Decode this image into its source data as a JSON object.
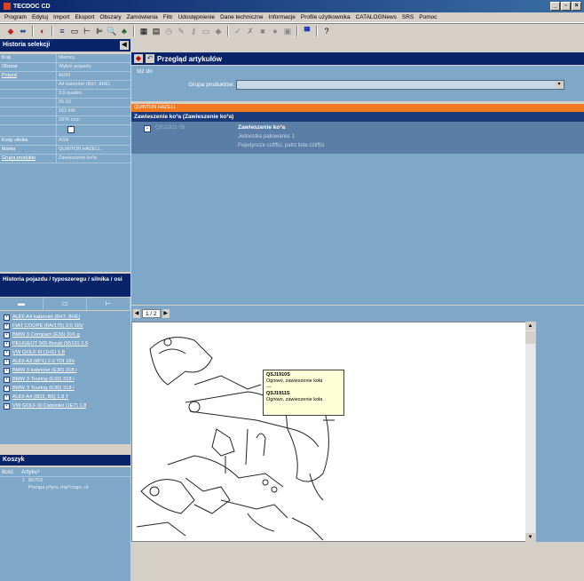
{
  "window": {
    "title": "TECDOC CD"
  },
  "menu": [
    "Program",
    "Edytuj",
    "Import",
    "Eksport",
    "Obszary",
    "Zamówienia",
    "Filtr",
    "Udostępnienie",
    "Dane techniczne",
    "Informacje",
    "Profile użytkownika",
    "CATALOGNews",
    "SRS",
    "Pomoc"
  ],
  "left": {
    "history_title": "Historia selekcji",
    "selection": [
      {
        "label": "Kraj",
        "value": "Niemcy",
        "link": false
      },
      {
        "label": "Obszar",
        "value": "Wybór pojazdu",
        "link": false
      },
      {
        "label": "Pojazd",
        "value": "AUDI",
        "link": true
      },
      {
        "label": "",
        "value": "A4 kabriolet (8H7, 8HE)",
        "link": false
      },
      {
        "label": "",
        "value": "3.0 quattro",
        "link": false
      },
      {
        "label": "",
        "value": "05.03",
        "link": false
      },
      {
        "label": "",
        "value": "162 kW",
        "link": false
      },
      {
        "label": "",
        "value": "2976 ccm",
        "link": false
      },
      {
        "label": "",
        "value": "",
        "link": false
      },
      {
        "label": "Kody silnika",
        "value": "ASN",
        "link": false
      },
      {
        "label": "Marka",
        "value": "QUINTON HAZELL",
        "link": false
      },
      {
        "label": "Grupa produktu",
        "value": "Zawieszenie ko³a",
        "link": true
      }
    ],
    "vehicle_history_title": "Historia pojazdu / typoszeregu / silnika / osi",
    "vehicle_history": [
      "AUDI A4 kabriolet (8H7, 8HE)",
      "FIAT COUPE (FA/175) 2.0 16V",
      "BMW 3 Compact (E36) 316 g",
      "PEUGEOT 505 Break (551D) 2.5",
      "VW GOLF III (1H1) 1.8",
      "AUDI A3 (8P1) 2.0 TDI 16V",
      "BMW 3 kabriolet (E30) 318 i",
      "BMW 3 Touring (E30) 318 i",
      "BMW 3 Touring (E30) 318 i",
      "AUDI A4 (8D2, B5) 1.8 T",
      "VW GOLF III Cabriolet (1E7) 1.8"
    ],
    "basket_title": "Koszyk",
    "basket_cols": [
      "Ilość",
      "Artyku³"
    ],
    "basket_rows": [
      {
        "qty": "1",
        "article": "80703"
      },
      {
        "qty": "",
        "article": "Pompa p³ynu ma³'cego, ol"
      }
    ]
  },
  "main": {
    "title": "Przegląd artykułów",
    "search_legend": "Idź do",
    "group_label": "Grupa produktów:",
    "group_value": "",
    "orange_label": "QUINTON HAZELL",
    "result_header": "Zawieszenie ko³a (Zawieszenie ko³a)",
    "result": {
      "number": "QSJ1911 06",
      "name": "Zawieszenie ko³a",
      "line2": "Jednostka pakowania: 1",
      "line3": "Pojedyncze czê¶ci, patrz lista czê¶ci"
    },
    "pager": "1 / 2",
    "tooltip": [
      {
        "code": "QSJ1910S",
        "desc": "Ogniwo, zawieszenie koła"
      },
      {
        "code": "QSJ1911S",
        "desc": "Ogniwo, zawieszenie koła"
      }
    ]
  }
}
